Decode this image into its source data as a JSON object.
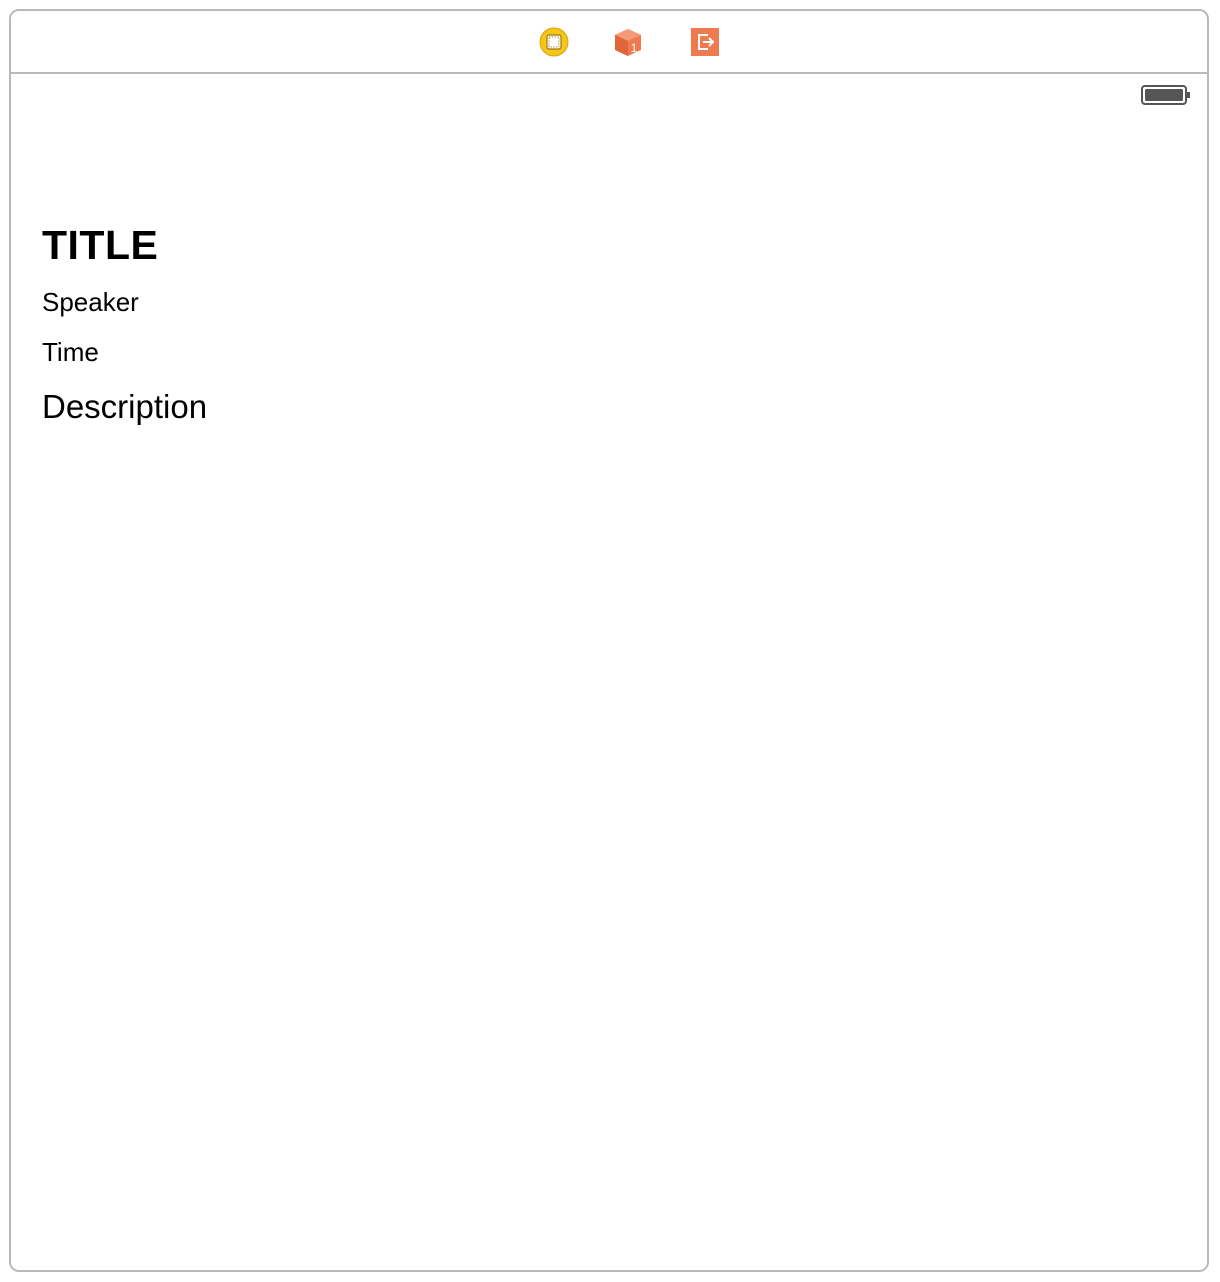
{
  "scene": {
    "dock": {
      "icons": [
        {
          "name": "view-controller-icon",
          "color": "#f5c518"
        },
        {
          "name": "first-responder-icon",
          "color": "#f07a4f"
        },
        {
          "name": "exit-icon",
          "color": "#f07a4f"
        }
      ]
    },
    "status_bar": {
      "battery": "battery-icon"
    },
    "labels": {
      "title": "TITLE",
      "speaker": "Speaker",
      "time": "Time",
      "description": "Description"
    }
  }
}
